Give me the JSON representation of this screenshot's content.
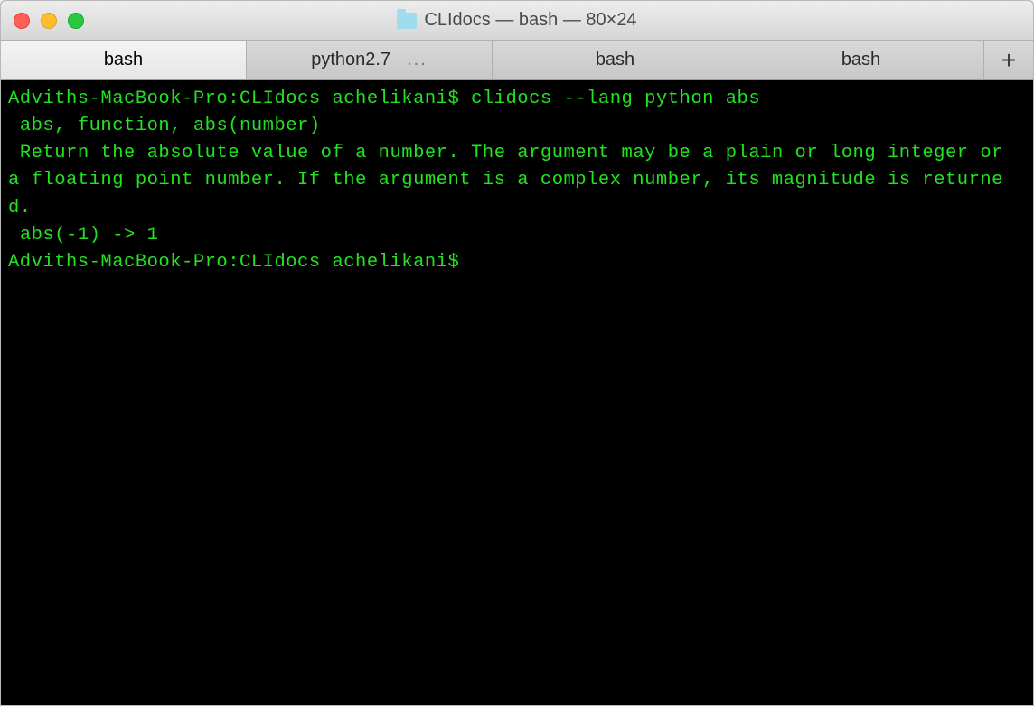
{
  "colors": {
    "terminal_fg": "#21e321",
    "terminal_bg": "#000000"
  },
  "titlebar": {
    "title": "CLIdocs — bash — 80×24"
  },
  "tabs": [
    {
      "label": "bash",
      "active": true,
      "extra": ""
    },
    {
      "label": "python2.7",
      "active": false,
      "extra": "..."
    },
    {
      "label": "bash",
      "active": false,
      "extra": ""
    },
    {
      "label": "bash",
      "active": false,
      "extra": ""
    }
  ],
  "newtab_label": "+",
  "terminal": {
    "lines": [
      "Adviths-MacBook-Pro:CLIdocs achelikani$ clidocs --lang python abs",
      "",
      " abs, function, abs(number)",
      "",
      " Return the absolute value of a number. The argument may be a plain or long integer or a floating point number. If the argument is a complex number, its magnitude is returned.",
      "",
      " abs(-1) -> 1",
      "",
      "Adviths-MacBook-Pro:CLIdocs achelikani$ "
    ]
  }
}
